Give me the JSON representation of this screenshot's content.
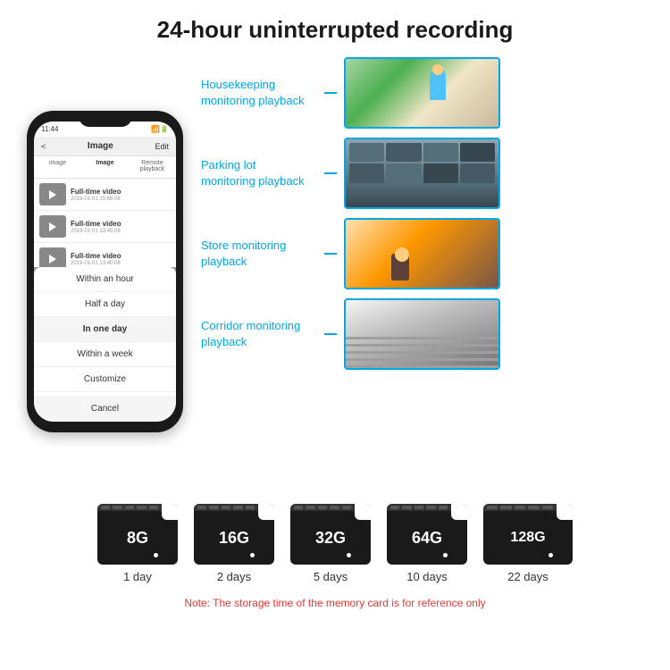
{
  "header": {
    "title": "24-hour uninterrupted recording"
  },
  "phone": {
    "time": "11:44",
    "nav_back": "<",
    "nav_title": "Image",
    "nav_edit": "Edit",
    "tabs": [
      "image",
      "Image",
      "Remote playback"
    ],
    "videos": [
      {
        "title": "Full-time video",
        "date": "2019-01-01 15:68:08"
      },
      {
        "title": "Full-time video",
        "date": "2019-01-01 13:45:08"
      },
      {
        "title": "Full-time video",
        "date": "2019-01-01 13:40:08"
      }
    ],
    "dropdown_items": [
      "Within an hour",
      "Half a day",
      "In one day",
      "Within a week",
      "Customize"
    ],
    "cancel_label": "Cancel"
  },
  "monitoring": [
    {
      "label": "Housekeeping\nmonitoring playback",
      "image_type": "housekeeping"
    },
    {
      "label": "Parking lot\nmonitoring playback",
      "image_type": "parking"
    },
    {
      "label": "Store monitoring\nplayback",
      "image_type": "store"
    },
    {
      "label": "Corridor monitoring\nplayback",
      "image_type": "corridor"
    }
  ],
  "sdcards": [
    {
      "size": "8G",
      "days": "1 day"
    },
    {
      "size": "16G",
      "days": "2 days"
    },
    {
      "size": "32G",
      "days": "5 days"
    },
    {
      "size": "64G",
      "days": "10 days"
    },
    {
      "size": "128G",
      "days": "22 days"
    }
  ],
  "note": "Note: The storage time of the memory card is for reference only",
  "colors": {
    "accent_blue": "#00a8e8",
    "note_red": "#e53935"
  }
}
